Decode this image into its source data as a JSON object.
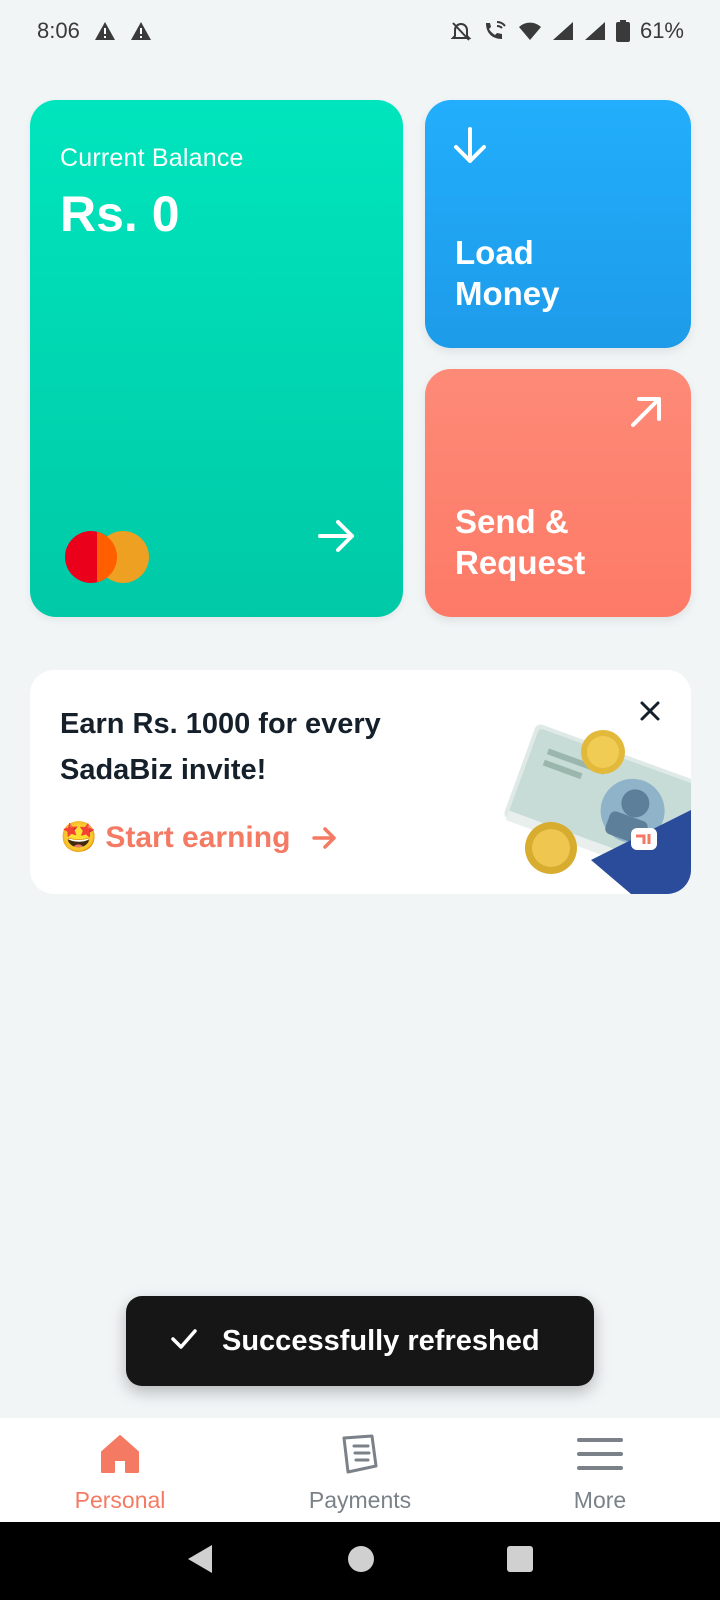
{
  "status_bar": {
    "time": "8:06",
    "battery": "61%",
    "left_icons": [
      "warning-icon",
      "warning-icon"
    ],
    "right_icons": [
      "bell-off-icon",
      "wifi-call-icon",
      "wifi-icon",
      "signal-icon",
      "signal-icon",
      "battery-icon"
    ]
  },
  "balance_card": {
    "label": "Current Balance",
    "value": "Rs. 0",
    "color": "#00d6b2"
  },
  "tiles": {
    "load_money": {
      "label_line1": "Load",
      "label_line2": "Money",
      "color": "#1fa6f4"
    },
    "send_request": {
      "label_line1": "Send &",
      "label_line2": "Request",
      "color": "#fd826f"
    }
  },
  "promo": {
    "title_line1": "Earn Rs. 1000 for every",
    "title_line2": "SadaBiz invite!",
    "emoji": "🤩",
    "cta": "Start earning"
  },
  "toast": {
    "message": "Successfully refreshed"
  },
  "bottom_nav": {
    "items": [
      {
        "label": "Personal",
        "icon": "home-icon",
        "active": true
      },
      {
        "label": "Payments",
        "icon": "receipt-icon",
        "active": false
      },
      {
        "label": "More",
        "icon": "menu-icon",
        "active": false
      }
    ],
    "accent_color": "#f47a63"
  }
}
